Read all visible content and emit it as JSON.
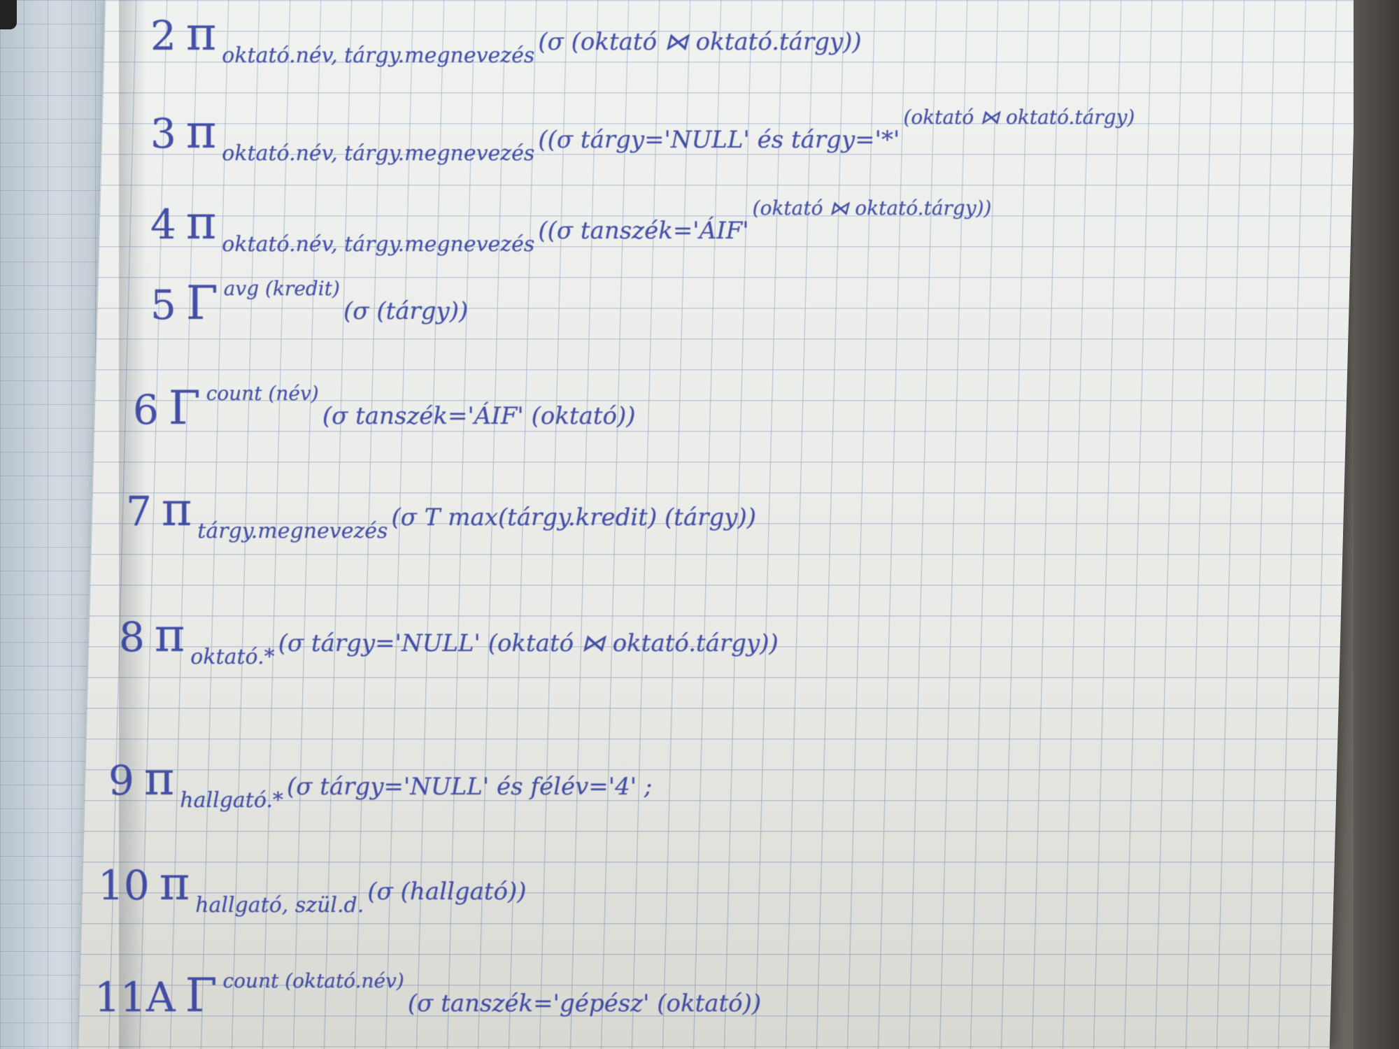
{
  "lines": [
    {
      "num": "2",
      "op": "π",
      "sub": "oktató.név, tárgy.megnevezés",
      "mid": "(σ (oktató ⋈ oktató.tárgy))",
      "sup": ""
    },
    {
      "num": "3",
      "op": "π",
      "sub": "oktató.név, tárgy.megnevezés",
      "mid": "((σ tárgy='NULL' és tárgy='*'",
      "sup": "(oktató ⋈ oktató.tárgy)"
    },
    {
      "num": "4",
      "op": "π",
      "sub": "oktató.név, tárgy.megnevezés",
      "mid": "((σ tanszék='ÁIF'",
      "sup": "(oktató ⋈ oktató.tárgy))"
    },
    {
      "num": "5",
      "op": "Γ",
      "sub": "",
      "mid": "(σ (tárgy))",
      "sup": "avg (kredit)"
    },
    {
      "num": "6",
      "op": "Γ",
      "sub": "",
      "mid": "(σ tanszék='ÁIF' (oktató))",
      "sup": "count (név)"
    },
    {
      "num": "7",
      "op": "π",
      "sub": "tárgy.megnevezés",
      "mid": "(σ T max(tárgy.kredit) (tárgy))",
      "sup": ""
    },
    {
      "num": "8",
      "op": "π",
      "sub": "oktató.*",
      "mid": "(σ tárgy='NULL' (oktató ⋈ oktató.tárgy))",
      "sup": ""
    },
    {
      "num": "9",
      "op": "π",
      "sub": "hallgató.*",
      "mid": "(σ tárgy='NULL' és félév='4' ;",
      "sup": ""
    },
    {
      "num": "10",
      "op": "π",
      "sub": "hallgató, szül.d.",
      "mid": "(σ (hallgató))",
      "sup": ""
    },
    {
      "num": "11A",
      "op": "Γ",
      "sub": "",
      "mid": "(σ tanszék='gépész' (oktató))",
      "sup": "count (oktató.név)"
    }
  ]
}
